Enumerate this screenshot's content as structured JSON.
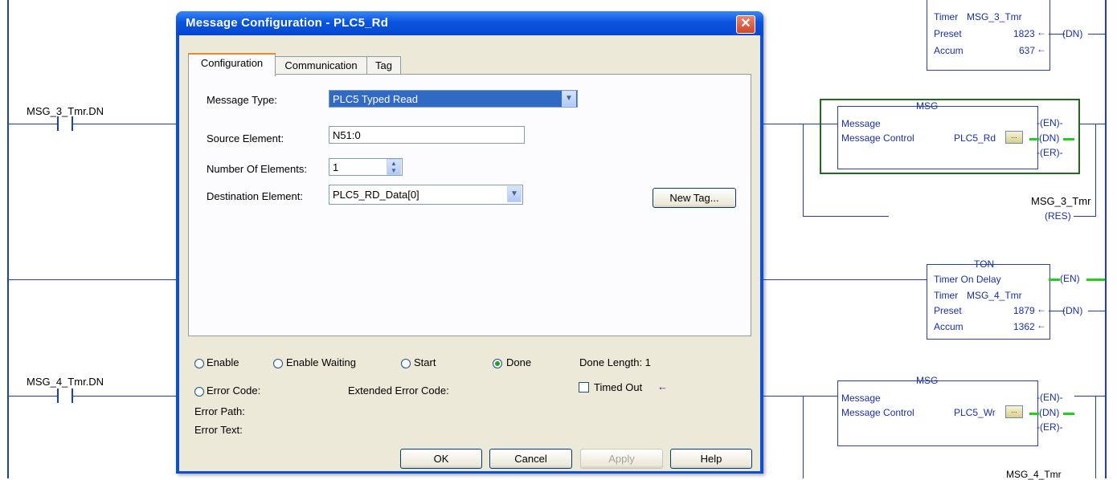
{
  "ladder": {
    "rung1_contact_tag": "MSG_3_Tmr.DN",
    "rung2_contact_tag": "MSG_4_Tmr.DN",
    "top_timer": {
      "timer_label": "Timer",
      "timer_tag": "MSG_3_Tmr",
      "preset_label": "Preset",
      "preset_value": "1823",
      "accum_label": "Accum",
      "accum_value": "637",
      "dn_coil": "DN"
    },
    "msg1": {
      "title": "MSG",
      "line1": "Message",
      "control_label": "Message Control",
      "control_tag": "PLC5_Rd",
      "en": "EN",
      "dn": "DN",
      "er": "ER"
    },
    "res_coil": {
      "tag": "MSG_3_Tmr",
      "label": "RES"
    },
    "ton2": {
      "title": "TON",
      "line1": "Timer On Delay",
      "timer_label": "Timer",
      "timer_tag": "MSG_4_Tmr",
      "preset_label": "Preset",
      "preset_value": "1879",
      "accum_label": "Accum",
      "accum_value": "1362",
      "en": "EN",
      "dn": "DN"
    },
    "msg2": {
      "title": "MSG",
      "line1": "Message",
      "control_label": "Message Control",
      "control_tag": "PLC5_Wr",
      "en": "EN",
      "dn": "DN",
      "er": "ER"
    },
    "bottom_partial_tag": "MSG_4_Tmr"
  },
  "dialog": {
    "title": "Message Configuration - PLC5_Rd",
    "tabs": [
      "Configuration",
      "Communication",
      "Tag"
    ],
    "message_type_label": "Message Type:",
    "message_type_value": "PLC5 Typed Read",
    "source_element_label": "Source Element:",
    "source_element_value": "N51:0",
    "num_elements_label": "Number Of Elements:",
    "num_elements_value": "1",
    "dest_element_label": "Destination Element:",
    "dest_element_value": "PLC5_RD_Data[0]",
    "new_tag_button": "New Tag...",
    "status": {
      "enable": "Enable",
      "enable_waiting": "Enable Waiting",
      "start": "Start",
      "done": "Done",
      "done_length": "Done Length: 1",
      "error_code": "Error Code:",
      "extended_error_code": "Extended Error Code:",
      "timed_out": "Timed Out",
      "error_path": "Error Path:",
      "error_text": "Error Text:"
    },
    "buttons": {
      "ok": "OK",
      "cancel": "Cancel",
      "apply": "Apply",
      "help": "Help"
    }
  },
  "colors": {
    "ladder_blue": "#1b3fb8",
    "active_green": "#22d01a",
    "msg_highlight": "#1f6a1c",
    "xp_title": "#0a55e0"
  }
}
